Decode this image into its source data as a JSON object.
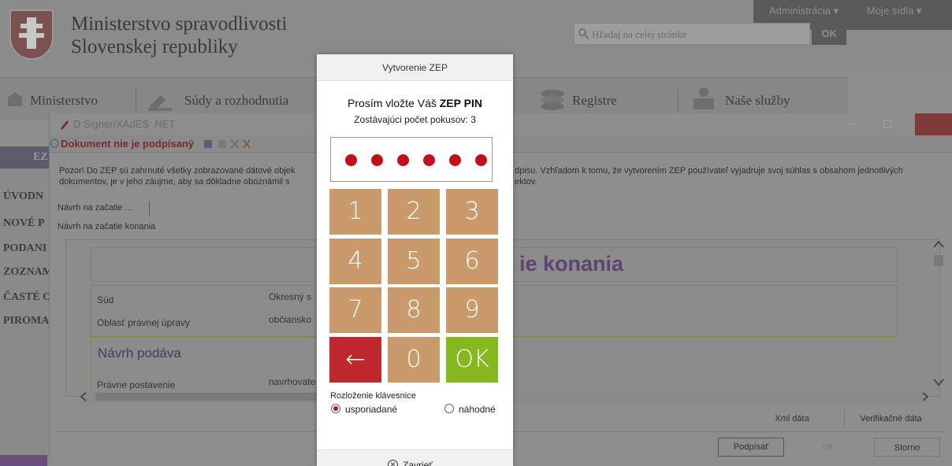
{
  "site": {
    "title_line1": "Ministerstvo spravodlivosti",
    "title_line2": "Slovenskej republiky",
    "topbar": {
      "admin": "Administrácia ▾",
      "mysites": "Moje sídla ▾"
    },
    "search": {
      "placeholder": "Hľadaj na celej stránke",
      "button": "OK"
    },
    "nav": {
      "item1": "Ministerstvo",
      "item2": "Súdy a rozhodnutia",
      "item3": "Registre",
      "item4": "Naše služby"
    },
    "left_menu": [
      "ÚVODN",
      "NOVÉ P",
      "PODANI",
      "ZOZNAM",
      "ČASTÉ O",
      "PIROMA"
    ],
    "ez_label": "EZ"
  },
  "signer": {
    "window_title": "D.Signer/XAdES .NET",
    "status": "Dokument nie je podpísaný",
    "notice_left": "Pozor! Do ZEP sú zahrnuté všetky zobrazované dátové objek",
    "notice_left2": "dokumentov, je v jeho záujme, aby sa dôkladne oboznámil s",
    "notice_right": "dpisu. Vzhľadom k tomu, že vytvorením ZEP používateľ vyjadruje svoj súhlas s obsahom jednotlivých",
    "notice_right2": "ektov.",
    "tab_short": "Návrh na začatie ...",
    "tab_full": "Návrh na začatie konania",
    "heading_part": "ie konania",
    "fields": {
      "sud_label": "Súd",
      "sud_value": "Okresný s",
      "oblast_label": "Oblasť právnej úpravy",
      "oblast_value": "občiansko",
      "navrh_podava": "Návrh podáva",
      "pravne_label": "Právne postavenie",
      "pravne_value": "navrhovate"
    },
    "buttons": {
      "xml": "Xml dáta",
      "verify": "Verifikačné dáta",
      "sign": "Podpísať",
      "ok": "OK",
      "cancel": "Storno"
    }
  },
  "modal": {
    "title": "Vytvorenie ZEP",
    "prompt_prefix": "Prosím vložte Váš ",
    "prompt_bold": "ZEP PIN",
    "attempts_label": "Zostávajúci počet pokusov: 3",
    "pin_length": 6,
    "keys": [
      "1",
      "2",
      "3",
      "4",
      "5",
      "6",
      "7",
      "8",
      "9",
      "←",
      "0",
      "OK"
    ],
    "layout_label": "Rozloženie klávesnice",
    "option_ordered": "usporiadané",
    "option_random": "náhodné",
    "selected_layout": "usporiadané",
    "close_label": "Zavrieť",
    "colors": {
      "digit": "#c89a6c",
      "back": "#c0282f",
      "ok": "#86b81f",
      "pin_dot": "#c20f1a"
    }
  }
}
